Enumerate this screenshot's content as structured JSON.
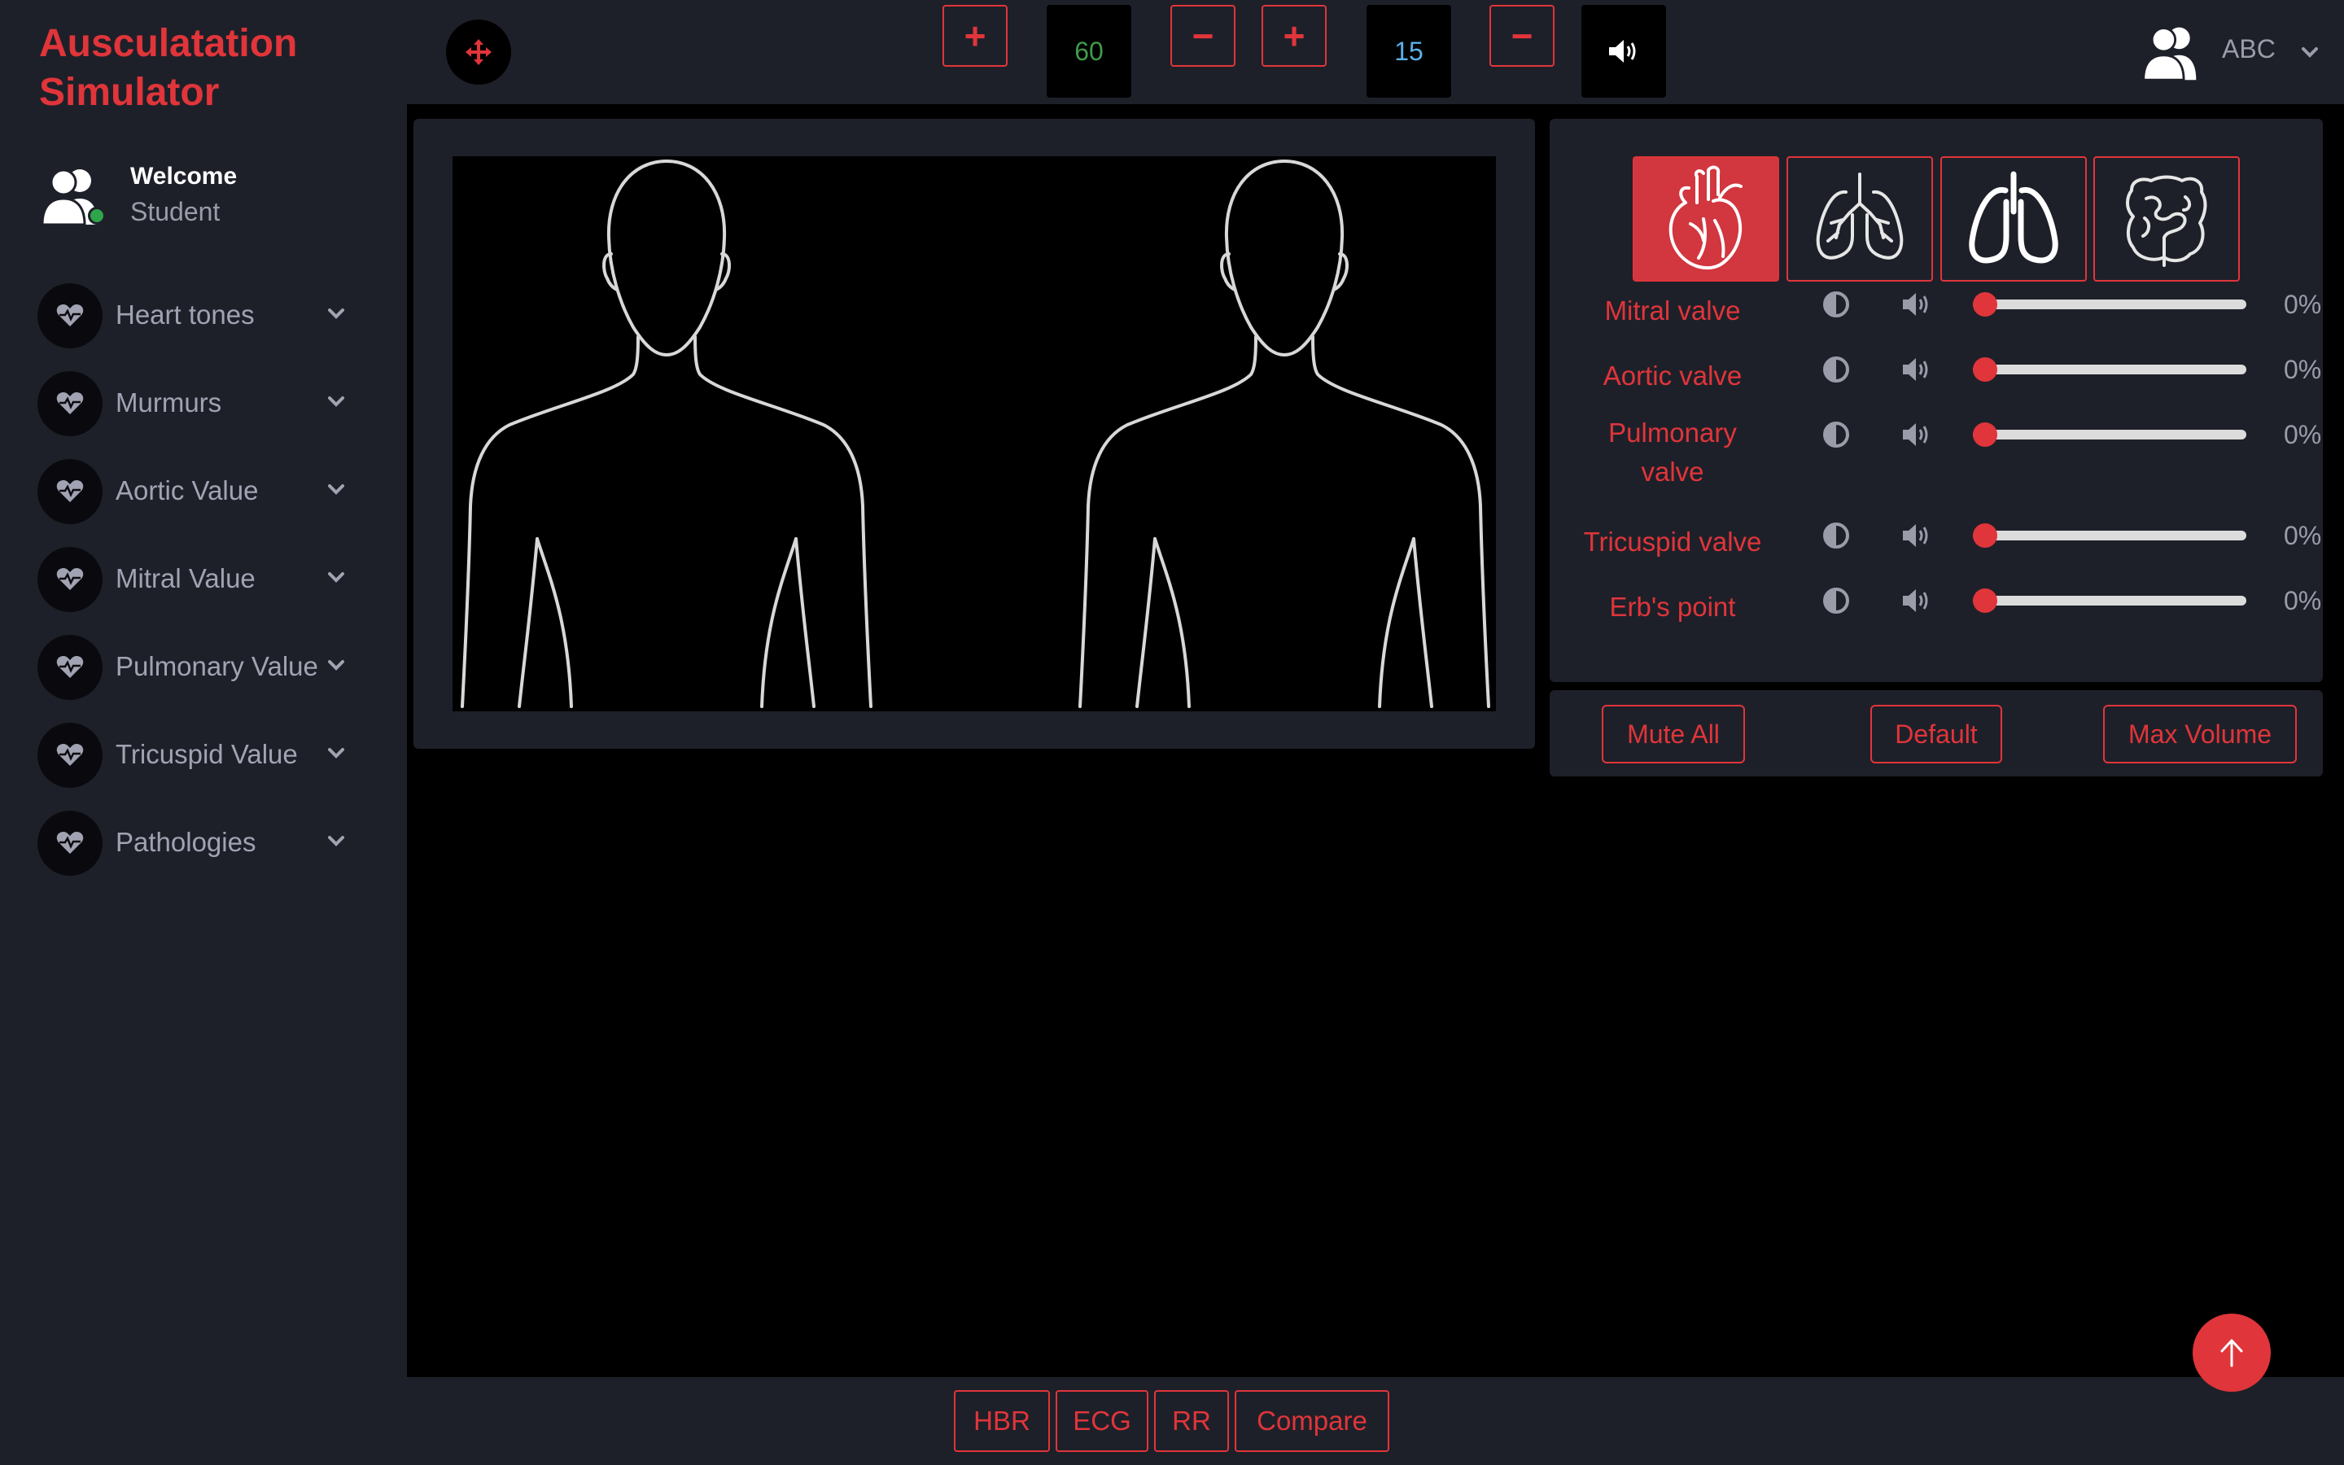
{
  "app": {
    "title": "Ausculatation Simulator"
  },
  "welcome": {
    "greeting": "Welcome",
    "role": "Student"
  },
  "sidebar": {
    "items": [
      {
        "label": "Heart tones"
      },
      {
        "label": "Murmurs"
      },
      {
        "label": "Aortic Value"
      },
      {
        "label": "Mitral Value"
      },
      {
        "label": "Pulmonary Value"
      },
      {
        "label": "Tricuspid Value"
      },
      {
        "label": "Pathologies"
      }
    ]
  },
  "topbar": {
    "heart_rate": "60",
    "resp_rate": "15",
    "plus": "+",
    "minus": "−",
    "user": "ABC"
  },
  "colors": {
    "accent": "#e0353a",
    "panel": "#1e2029",
    "hr_value": "#3f9a4a",
    "rr_value": "#5bb0e8"
  },
  "organ_tabs": [
    "heart-icon",
    "lungs-bronchi-icon",
    "lungs-outline-icon",
    "intestines-icon"
  ],
  "valves": [
    {
      "label": "Mitral valve",
      "value": "0%",
      "level": 0
    },
    {
      "label": "Aortic valve",
      "value": "0%",
      "level": 0
    },
    {
      "label": "Pulmonary valve",
      "value": "0%",
      "level": 0
    },
    {
      "label": "Tricuspid valve",
      "value": "0%",
      "level": 0
    },
    {
      "label": "Erb's point",
      "value": "0%",
      "level": 0
    }
  ],
  "actions": {
    "mute_all": "Mute All",
    "default": "Default",
    "max_volume": "Max Volume"
  },
  "bottom": {
    "hbr": "HBR",
    "ecg": "ECG",
    "rr": "RR",
    "compare": "Compare"
  }
}
